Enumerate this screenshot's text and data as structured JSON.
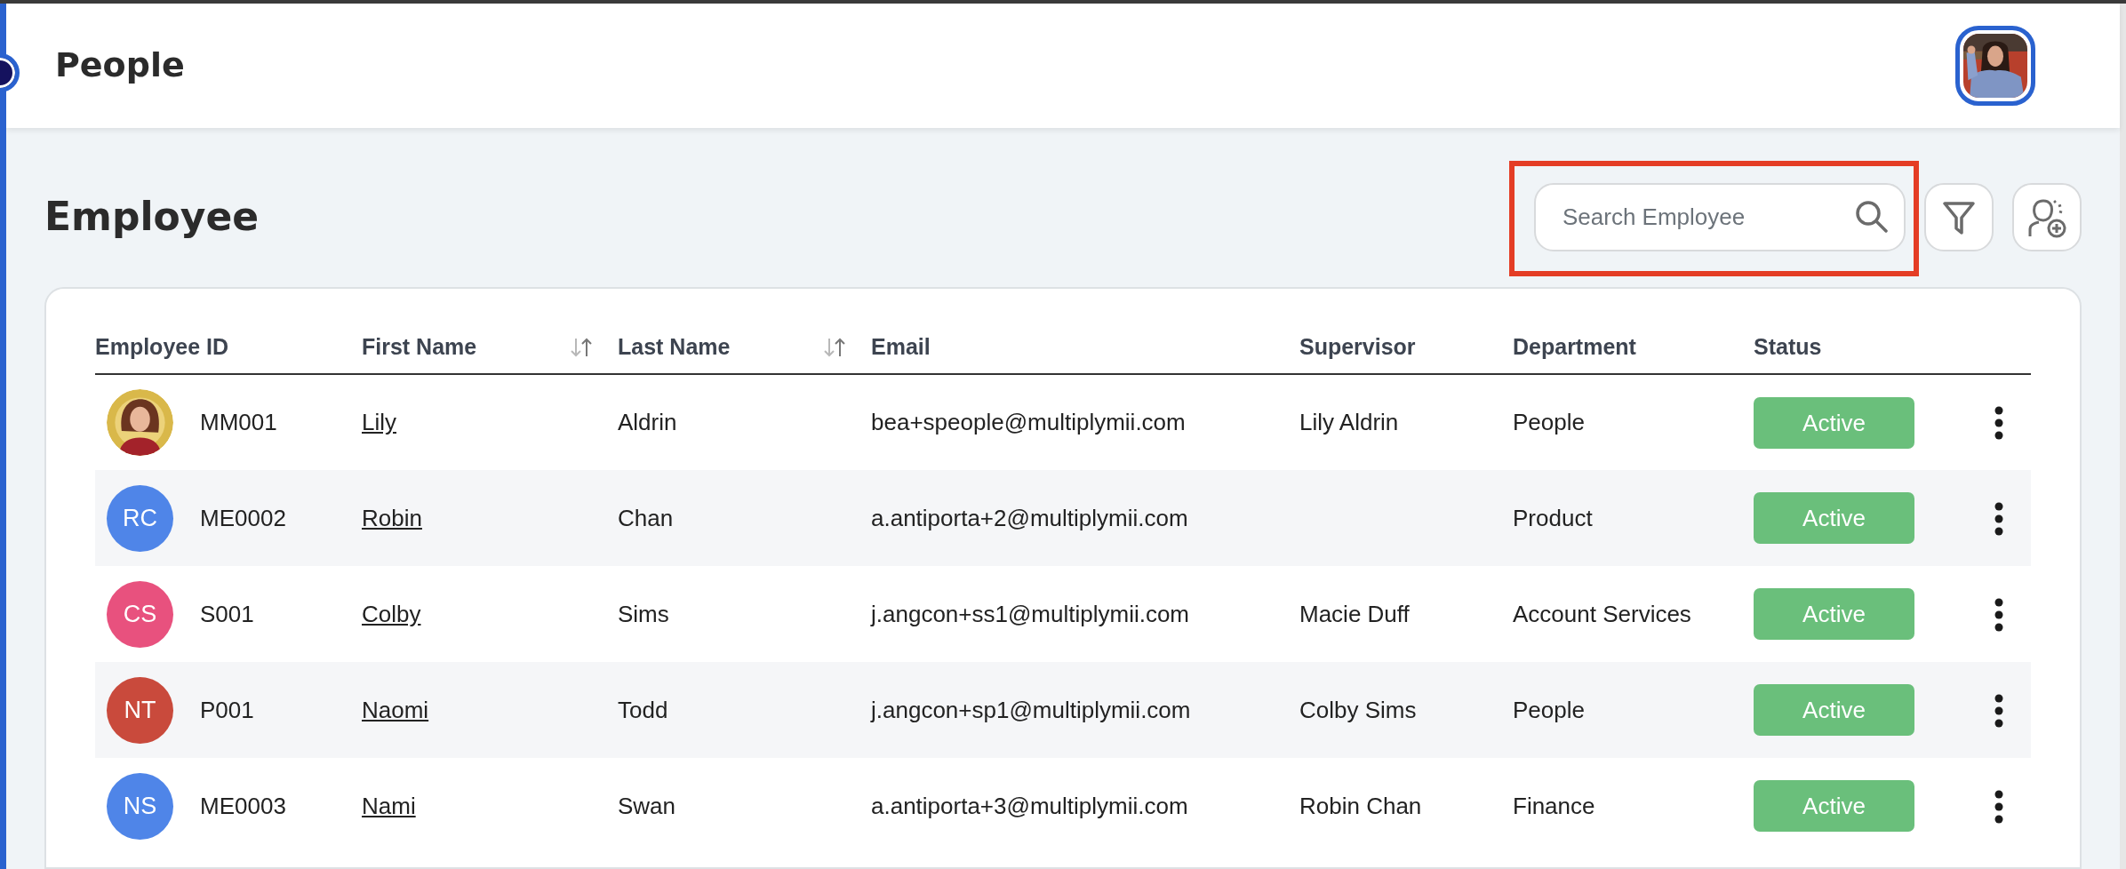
{
  "header": {
    "title": "People"
  },
  "page_title": "Employee",
  "search": {
    "placeholder": "Search Employee",
    "highlighted": true
  },
  "table": {
    "columns": [
      {
        "label": "Employee ID",
        "sortable": false
      },
      {
        "label": "First Name",
        "sortable": true
      },
      {
        "label": "Last Name",
        "sortable": true
      },
      {
        "label": "Email",
        "sortable": false
      },
      {
        "label": "Supervisor",
        "sortable": false
      },
      {
        "label": "Department",
        "sortable": false
      },
      {
        "label": "Status",
        "sortable": false
      }
    ],
    "rows": [
      {
        "id": "MM001",
        "first_name": "Lily",
        "last_name": "Aldrin",
        "email": "bea+speople@multiplymii.com",
        "supervisor": "Lily Aldrin",
        "department": "People",
        "status": "Active"
      },
      {
        "avatar": {
          "kind": "initials",
          "initials": "RC",
          "color": "#4f85e8"
        },
        "id": "ME0002",
        "first_name": "Robin",
        "last_name": "Chan",
        "email": "a.antiporta+2@multiplymii.com",
        "department": "Product",
        "status": "Active"
      },
      {
        "avatar": {
          "kind": "initials",
          "initials": "CS",
          "color": "#e8517e"
        },
        "id": "S001",
        "first_name": "Colby",
        "last_name": "Sims",
        "email": "j.angcon+ss1@multiplymii.com",
        "supervisor": "Macie Duff",
        "department": "Account Services",
        "status": "Active"
      },
      {
        "avatar": {
          "kind": "initials",
          "initials": "NT",
          "color": "#c94a3c"
        },
        "id": "P001",
        "first_name": "Naomi",
        "last_name": "Todd",
        "email": "j.angcon+sp1@multiplymii.com",
        "supervisor": "Colby Sims",
        "department": "People",
        "status": "Active"
      },
      {
        "avatar": {
          "kind": "initials",
          "initials": "NS",
          "color": "#4f85e8"
        },
        "id": "ME0003",
        "first_name": "Nami",
        "last_name": "Swan",
        "email": "a.antiporta+3@multiplymii.com",
        "supervisor": "Robin Chan",
        "department": "Finance",
        "status": "Active"
      }
    ]
  }
}
